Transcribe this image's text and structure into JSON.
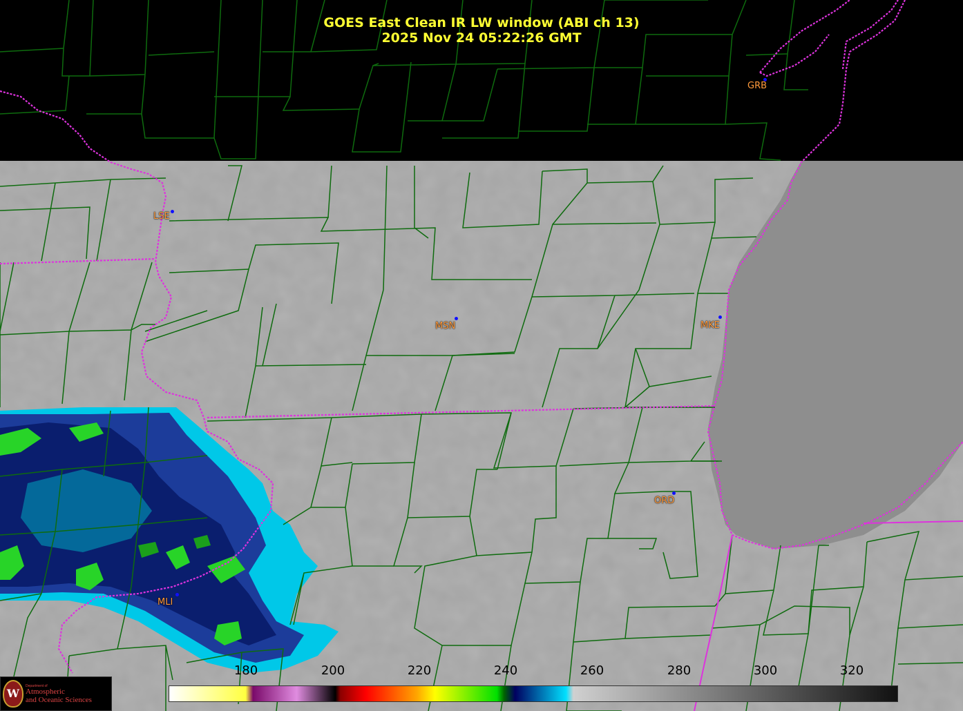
{
  "title": {
    "line1": "GOES East Clean IR LW window (ABI ch 13)",
    "line2": "2025 Nov 24  05:22:26 GMT"
  },
  "stations": [
    {
      "code": "GRB"
    },
    {
      "code": "LSE"
    },
    {
      "code": "MSN"
    },
    {
      "code": "MKE"
    },
    {
      "code": "ORD"
    },
    {
      "code": "MLI"
    }
  ],
  "colorbar": {
    "ticks": [
      "180",
      "200",
      "220",
      "240",
      "260",
      "280",
      "300",
      "320"
    ],
    "gradient_stops": [
      "#ffffff",
      "#ffff40",
      "#7a0a6a",
      "#e08ce0",
      "#000000",
      "#8b0000",
      "#ff0000",
      "#ffa500",
      "#ffff00",
      "#00e000",
      "#006400",
      "#000060",
      "#00e0ff",
      "#d0d0d0",
      "#111111"
    ]
  },
  "colors": {
    "county_lines": "#0e6b0e",
    "state_lines": "#dd33dd",
    "title": "#ffff33",
    "station_label": "#ff9a3c"
  },
  "logo": {
    "seal": "W",
    "small": "Department of",
    "line1": "Atmospheric",
    "line2": "and Oceanic Sciences"
  }
}
